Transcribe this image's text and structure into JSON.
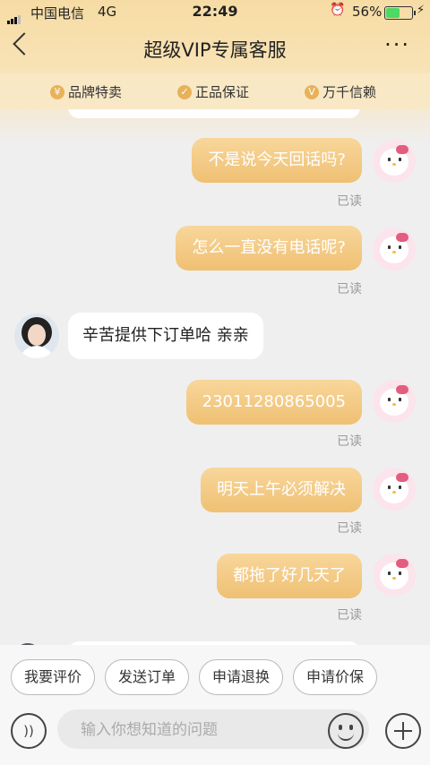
{
  "status_bar": {
    "carrier": "中国电信",
    "network": "4G",
    "time": "22:49",
    "battery_percent": "56%",
    "battery_level": 0.56
  },
  "nav": {
    "title": "超级VIP专属客服",
    "more_label": "···"
  },
  "trust": [
    {
      "label": "品牌特卖",
      "icon": "brand-icon"
    },
    {
      "label": "正品保证",
      "icon": "shield-icon"
    },
    {
      "label": "万千信赖",
      "icon": "v-badge-icon"
    }
  ],
  "messages": [
    {
      "from": "user",
      "text": "不是说今天回话吗?",
      "status": "已读"
    },
    {
      "from": "user",
      "text": "怎么一直没有电话呢?",
      "status": "已读"
    },
    {
      "from": "agent",
      "text": "辛苦提供下订单哈  亲亲"
    },
    {
      "from": "user",
      "text": "23011280865005",
      "status": "已读"
    },
    {
      "from": "user",
      "text": "明天上午必须解决",
      "status": "已读"
    },
    {
      "from": "user",
      "text": "都拖了好几天了",
      "status": "已读"
    }
  ],
  "quick_replies": [
    "我要评价",
    "发送订单",
    "申请退换",
    "申请价保"
  ],
  "input": {
    "placeholder": "输入你想知道的问题",
    "value": ""
  },
  "colors": {
    "accent": "#efc073",
    "header": "#f6dca4"
  }
}
